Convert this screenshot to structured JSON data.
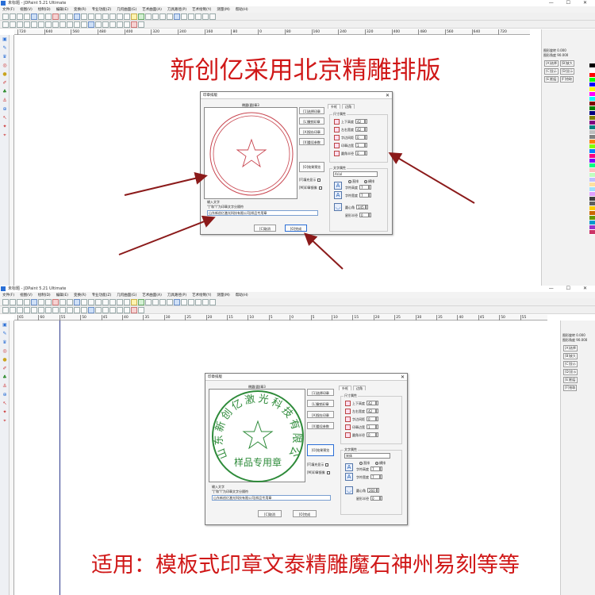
{
  "app": {
    "title_top": "未标题 - JDPaint 5.21 Ultimate",
    "title_bottom": "未标题 - JDPaint 5.21 Ultimate",
    "menu": [
      "文件(F)",
      "视图(V)",
      "绘制(D)",
      "编辑(E)",
      "变换(R)",
      "专业功能(Z)",
      "几何曲面(G)",
      "艺术曲面(A)",
      "刀具路径(P)",
      "艺术绘制(Y)",
      "测量(M)",
      "帮助(H)"
    ]
  },
  "ruler_top": {
    "labels": [
      "720",
      "640",
      "560",
      "480",
      "400",
      "320",
      "240",
      "160",
      "80",
      "0",
      "80",
      "160",
      "240",
      "320",
      "400",
      "480",
      "560",
      "640",
      "720"
    ],
    "unit": "mm"
  },
  "ruler_bottom": {
    "labels": [
      "65",
      "60",
      "55",
      "50",
      "45",
      "40",
      "35",
      "30",
      "25",
      "20",
      "15",
      "10",
      "5",
      "0",
      "5",
      "10",
      "15",
      "20",
      "25",
      "30",
      "35",
      "40",
      "45",
      "50",
      "55"
    ]
  },
  "right_panel": {
    "rows": [
      {
        "label": "图形旋转",
        "value": "0.000"
      },
      {
        "label": "图形角度",
        "value": "90.000"
      }
    ],
    "buttons": [
      "[A]选择",
      "[B]放大",
      "[C]显示",
      "[D]显示",
      "[E]图层",
      "[F]拾取"
    ]
  },
  "palette_colors": [
    "#000000",
    "#ffffff",
    "#ff0000",
    "#00ff00",
    "#0000ff",
    "#ffff00",
    "#ff00ff",
    "#00ffff",
    "#800000",
    "#008000",
    "#000080",
    "#808000",
    "#800080",
    "#008080",
    "#c0c0c0",
    "#808080",
    "#ff8000",
    "#80ff00",
    "#0080ff",
    "#ff0080",
    "#8000ff",
    "#00ff80",
    "#ffc0c0",
    "#c0ffc0",
    "#c0c0ff",
    "#ffe0a0",
    "#a0e0ff",
    "#e0a0ff",
    "#404040",
    "#606060",
    "#ffcc00",
    "#cc6600",
    "#669900",
    "#0099cc",
    "#9933cc",
    "#cc3366"
  ],
  "heading_top": "新创亿采用北京精雕排版",
  "heading_bottom": "适用：模板式印章文泰精雕魔石神州易刻等等",
  "dialog": {
    "title": "印章排版",
    "preview_title": "椭圆(圆)章3",
    "buttons": [
      "[1]选择印章",
      "[L]撤销印章",
      "[A]保存印章",
      "[X]重设参数"
    ],
    "effect_button": "[O]效果预览",
    "checkbox_fill": "[F]填充显示",
    "checkbox_mirror": "[M]印章镜像",
    "input_label": "输入文字",
    "input_hint": "\"|\"和\"\\\"为印章文字分隔符",
    "input_value": "山东新创亿激光科技有限公司|样品专用章",
    "cancel_button": "[C]取消",
    "ok_button": "[O]完成",
    "tabs": [
      "外框",
      "边角"
    ],
    "size_group": "尺寸属性",
    "size_props": [
      {
        "label": "上下高度",
        "value": "42"
      },
      {
        "label": "左右宽度",
        "value": "42"
      },
      {
        "label": "字边间距",
        "value": "0"
      },
      {
        "label": "印章边宽",
        "value": "1"
      },
      {
        "label": "圆角半径",
        "value": "0"
      }
    ],
    "text_group": "文字属性",
    "font_value_top": "Arial",
    "font_value_bottom": "宋体",
    "radio_straight": "直排",
    "radio_horizontal": "横排",
    "char_props": [
      {
        "label": "字符高度",
        "value": "7"
      },
      {
        "label": "字符宽度",
        "value": "7"
      }
    ],
    "arc_label": "圆心角",
    "arc_top": "145",
    "arc_bottom": "260",
    "star_label": "星形半径",
    "star_value": "0"
  },
  "stamp": {
    "circle_text": "山东新创亿激光科技有限公司",
    "bottom_text": "样品专用章",
    "color_top": "#c8454f",
    "color_bottom": "#2e8b3a"
  },
  "arrow_color": "#8b1a1a",
  "heading_color": "#d01818"
}
